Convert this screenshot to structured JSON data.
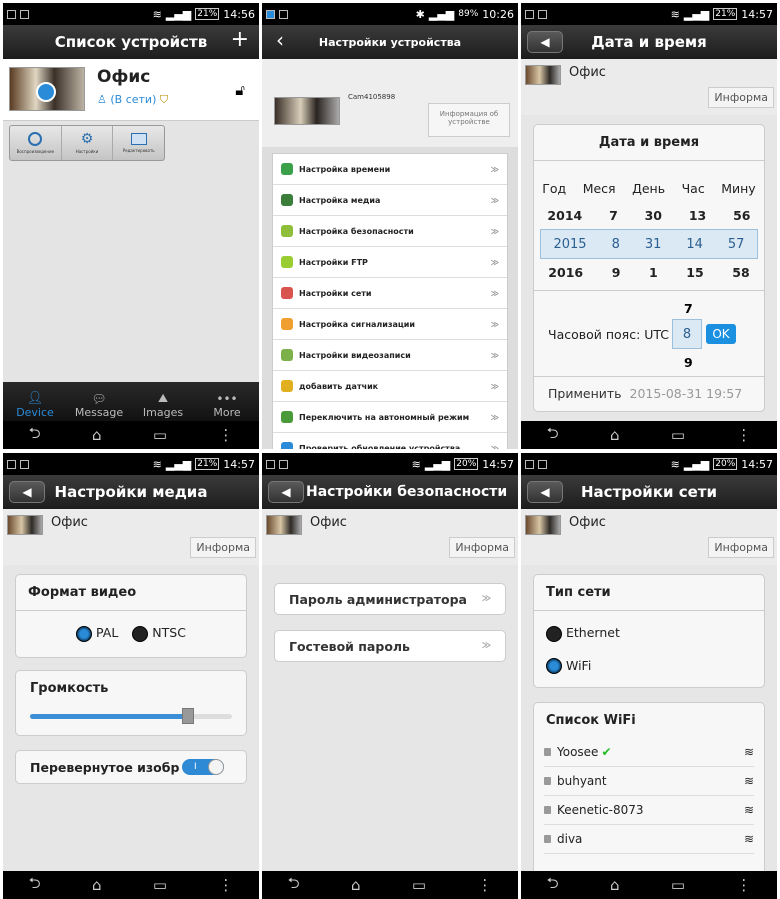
{
  "status": {
    "p1": {
      "battery": "21%",
      "time": "14:56"
    },
    "p2": {
      "battery": "89%",
      "time": "10:26"
    },
    "p3": {
      "battery": "21%",
      "time": "14:57"
    },
    "p4": {
      "battery": "21%",
      "time": "14:57"
    },
    "p5": {
      "battery": "20%",
      "time": "14:57"
    },
    "p6": {
      "battery": "20%",
      "time": "14:57"
    }
  },
  "nav_icons": [
    "back-icon",
    "home-icon",
    "recents-icon",
    "menu-dots-icon"
  ],
  "device_list": {
    "title": "Список устройств",
    "add": "+",
    "device_name": "Офис",
    "device_status": "(В сети)",
    "actions": [
      "Воспроизведение",
      "Настройки",
      "Редактировать"
    ],
    "tabs": [
      "Device",
      "Message",
      "Images",
      "More"
    ],
    "tab_icons": [
      "person-icon",
      "chat-icon",
      "image-icon",
      "more-icon"
    ]
  },
  "device_settings": {
    "title": "Настройки устройства",
    "camera_id": "Cam4105898",
    "info_button": "Информация об устройстве",
    "items": [
      {
        "label": "Настройка времени",
        "color": "#3aa04a"
      },
      {
        "label": "Настройка медиа",
        "color": "#3b7d3a"
      },
      {
        "label": "Настройка безопасности",
        "color": "#8fbf3a"
      },
      {
        "label": "Настройки FTP",
        "color": "#9acd32"
      },
      {
        "label": "Настройки сети",
        "color": "#d9534f"
      },
      {
        "label": "Настройка сигнализации",
        "color": "#f0a030"
      },
      {
        "label": "Настройки видеозаписи",
        "color": "#7bb04a"
      },
      {
        "label": "добавить датчик",
        "color": "#e0b020"
      },
      {
        "label": "Переключить на автономный режим",
        "color": "#4a9a3a"
      },
      {
        "label": "Проверить обновление устройства",
        "color": "#2a8bd8"
      }
    ]
  },
  "datetime": {
    "title": "Дата и время",
    "device_name": "Офис",
    "info_button": "Информа",
    "card_title": "Дата и время",
    "headers": [
      "Год",
      "Меся",
      "День",
      "Час",
      "Мину"
    ],
    "row_above": [
      "2014",
      "7",
      "30",
      "13",
      "56"
    ],
    "row_selected": [
      "2015",
      "8",
      "31",
      "14",
      "57"
    ],
    "row_below": [
      "2016",
      "9",
      "1",
      "15",
      "58"
    ],
    "tz_label": "Часовой пояс: UTC",
    "tz_above": "7",
    "tz_value": "8",
    "tz_below": "9",
    "ok": "OK",
    "apply_label": "Применить",
    "apply_value": "2015-08-31 19:57"
  },
  "media": {
    "title": "Настройки медиа",
    "device_name": "Офис",
    "info_button": "Информа",
    "video_format_title": "Формат видео",
    "pal": "PAL",
    "ntsc": "NTSC",
    "volume_title": "Громкость",
    "volume_level": 0.78,
    "flip_label": "Перевернутое изображ",
    "flip_state": "I"
  },
  "security": {
    "title": "Настройки безопасности",
    "device_name": "Офис",
    "info_button": "Информа",
    "admin_password": "Пароль администратора",
    "guest_password": "Гостевой пароль",
    "arrow": "≫"
  },
  "network": {
    "title": "Настройки сети",
    "device_name": "Офис",
    "info_button": "Информа",
    "net_type_title": "Тип сети",
    "ethernet": "Ethernet",
    "wifi": "WiFi",
    "wifi_list_title": "Список WiFi",
    "networks": [
      "Yoosee",
      "buhyant",
      "Keenetic-8073",
      "diva"
    ],
    "connected_mark": "✔"
  }
}
